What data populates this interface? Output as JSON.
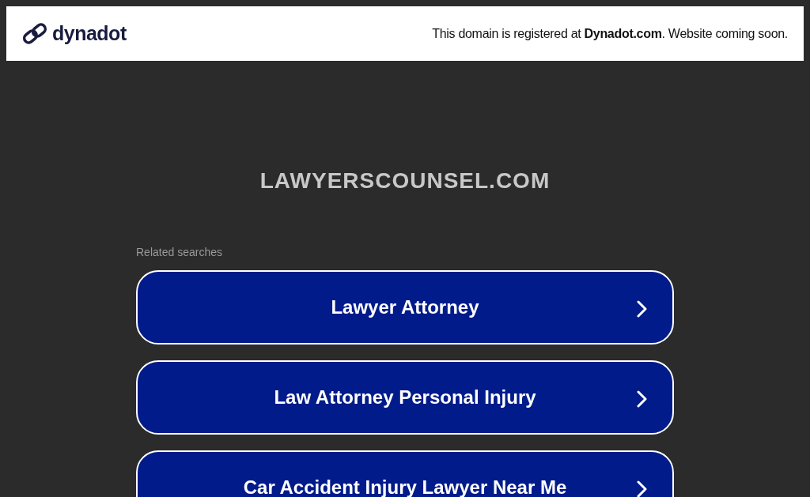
{
  "header": {
    "logo_text": "dynadot",
    "notice": "This domain is registered at **Dynadot.com**. Website coming soon."
  },
  "domain": "LAWYERSCOUNSEL.COM",
  "related": {
    "label": "Related searches",
    "links": [
      {
        "label": "Lawyer Attorney"
      },
      {
        "label": "Law Attorney Personal Injury"
      },
      {
        "label": "Car Accident Injury Lawyer Near Me"
      }
    ]
  }
}
